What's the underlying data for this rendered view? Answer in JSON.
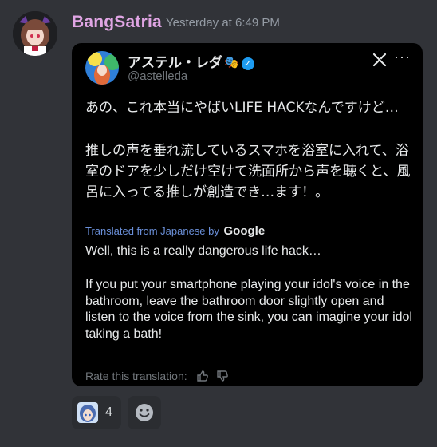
{
  "message": {
    "username": "BangSatria",
    "timestamp": "Yesterday at 6:49 PM",
    "username_color": "#e0a5e4",
    "avatar_icon": "anime-girl-avatar"
  },
  "tweet": {
    "display_name": "アステル・レダ",
    "handle": "@astelleda",
    "verified_icon": "verified-badge-icon",
    "jp_line_1": "あの、これ本当にやばいLIFE HACKなんですけど…",
    "jp_line_2": "推しの声を垂れ流しているスマホを浴室に入れて、浴室のドアを少しだけ空けて洗面所から声を聴くと、風呂に入ってる推しが創造でき…ます！。",
    "translated_label": "Translated from Japanese by",
    "translator": "Google",
    "en_line_1": "Well, this is a really dangerous life hack…",
    "en_line_2": "If you put your smartphone playing your idol's voice in the bathroom, leave the bathroom door slightly open and listen to the voice from the sink, you can imagine your idol taking a bath!",
    "rate_label": "Rate this translation:"
  },
  "reactions": [
    {
      "icon": "anime-emoji",
      "count": "4"
    }
  ],
  "colors": {
    "background": "#313338",
    "embed": "#000000",
    "link": "#6a8fd8"
  }
}
